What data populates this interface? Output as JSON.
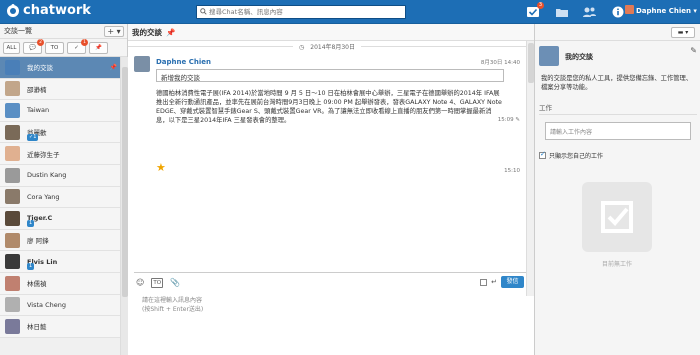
{
  "app": {
    "name": "chatwork",
    "search_placeholder": "搜尋Chat名稱、訊息內容",
    "user": "Daphne Chien"
  },
  "topbar": {
    "task_badge": "3"
  },
  "sidebar": {
    "header": "交談一覽",
    "add_label": "+",
    "filters": [
      {
        "label": "ALL",
        "badge": ""
      },
      {
        "label": "💬",
        "badge": "2"
      },
      {
        "label": "TO",
        "badge": ""
      },
      {
        "label": "✓",
        "badge": "1"
      },
      {
        "label": "📌",
        "badge": ""
      }
    ],
    "rooms": [
      {
        "name": "我的交談",
        "selected": true,
        "bold": false,
        "badge": "",
        "color": "#4a7fb8"
      },
      {
        "name": "邵瀞楠",
        "selected": false,
        "bold": false,
        "badge": "",
        "color": "#c2a68a"
      },
      {
        "name": "Taiwan",
        "selected": false,
        "bold": false,
        "badge": "",
        "color": "#5a8fc4"
      },
      {
        "name": "翁麗歡",
        "selected": false,
        "bold": false,
        "badge": "✓1",
        "color": "#7a6a58"
      },
      {
        "name": "近藤弥生子",
        "selected": false,
        "bold": false,
        "badge": "",
        "color": "#e0b090"
      },
      {
        "name": "Dustin Kang",
        "selected": false,
        "bold": false,
        "badge": "",
        "color": "#9a9a9a"
      },
      {
        "name": "Cora Yang",
        "selected": false,
        "bold": false,
        "badge": "",
        "color": "#8a7a6a"
      },
      {
        "name": "Tiger.C",
        "selected": false,
        "bold": true,
        "badge": "1",
        "color": "#5a4a3a"
      },
      {
        "name": "廖 阿鋒",
        "selected": false,
        "bold": false,
        "badge": "",
        "color": "#b08a6a"
      },
      {
        "name": "Elvis Lin",
        "selected": false,
        "bold": true,
        "badge": "1",
        "color": "#3a3a3a"
      },
      {
        "name": "林儒禎",
        "selected": false,
        "bold": false,
        "badge": "",
        "color": "#c08070"
      },
      {
        "name": "Vista Cheng",
        "selected": false,
        "bold": false,
        "badge": "",
        "color": "#b0b0b0"
      },
      {
        "name": "林日懿",
        "selected": false,
        "bold": false,
        "badge": "",
        "color": "#7a7a9a"
      }
    ]
  },
  "chat": {
    "title": "我的交談",
    "date": "2014年8月30日",
    "sender": "Daphne Chien",
    "message_time": "8月30日 14:40",
    "quote": "新增我的交談",
    "body": "德國柏林消費性電子展(IFA 2014)於當地時間 9 月 5 日～10 日在柏林會展中心舉辦，三星電子在德國舉辦的2014年 IFA展推出全新行動通訊產品，並率先在展前台灣時間9月3日晚上 09:00 PM 起舉辦發表，發表GALAXY Note 4、GALAXY Note EDGE、穿戴式裝置智慧手錶Gear S、頭戴式裝置Gear VR。為了讓無法立即收看線上直播的朋友們第一時間掌握最新消息，以下是三星2014年IFA 三星發表會的整理。",
    "time2": "15:09",
    "time3": "15:10",
    "composer": {
      "send": "發信",
      "placeholder_line1": "請在這裡輸入訊息內容",
      "placeholder_line2": "(按Shift + Enter送出)"
    }
  },
  "info": {
    "title": "我的交談",
    "description": "我的交談是您的私人工具，提供您備忘錄、工作管理、檔案分享等功能。",
    "task_section": "工作",
    "task_placeholder": "請輸入工作內容",
    "only_mine": "只顯示您自己的工作",
    "no_task": "目前無工作"
  }
}
